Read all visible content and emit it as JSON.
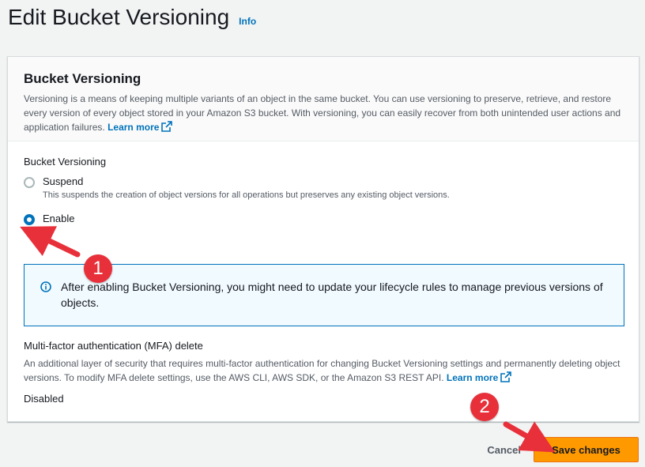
{
  "header": {
    "title": "Edit Bucket Versioning",
    "info_link": "Info"
  },
  "panel": {
    "title": "Bucket Versioning",
    "description": "Versioning is a means of keeping multiple variants of an object in the same bucket. You can use versioning to preserve, retrieve, and restore every version of every object stored in your Amazon S3 bucket. With versioning, you can easily recover from both unintended user actions and application failures.",
    "learn_more": "Learn more"
  },
  "versioning": {
    "label": "Bucket Versioning",
    "options": [
      {
        "label": "Suspend",
        "description": "This suspends the creation of object versions for all operations but preserves any existing object versions.",
        "selected": false
      },
      {
        "label": "Enable",
        "description": "",
        "selected": true
      }
    ]
  },
  "alert": {
    "text": "After enabling Bucket Versioning, you might need to update your lifecycle rules to manage previous versions of objects."
  },
  "mfa": {
    "title": "Multi-factor authentication (MFA) delete",
    "description": "An additional layer of security that requires multi-factor authentication for changing Bucket Versioning settings and permanently deleting object versions. To modify MFA delete settings, use the AWS CLI, AWS SDK, or the Amazon S3 REST API.",
    "learn_more": "Learn more",
    "value": "Disabled"
  },
  "footer": {
    "cancel_label": "Cancel",
    "save_label": "Save changes"
  },
  "annotations": {
    "step1": "1",
    "step2": "2"
  },
  "colors": {
    "link": "#0073bb",
    "primary_button": "#ff9900",
    "annotation": "#e8303a"
  },
  "icons": {
    "external_link": "external-link-icon",
    "info": "info-circle-icon"
  }
}
